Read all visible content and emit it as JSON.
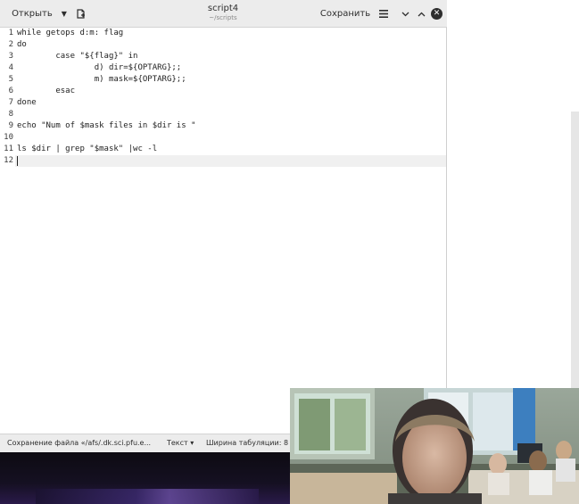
{
  "window": {
    "title": "script4",
    "path": "~/scripts"
  },
  "header": {
    "open_label": "Открыть",
    "save_label": "Сохранить"
  },
  "editor": {
    "line_numbers": [
      "1",
      "2",
      "3",
      "4",
      "5",
      "6",
      "7",
      "8",
      "9",
      "10",
      "11",
      "12"
    ],
    "lines": [
      "while getops d:m: flag",
      "do",
      "        case \"${flag}\" in",
      "                d) dir=${OPTARG};;",
      "                m) mask=${OPTARG};;",
      "        esac",
      "done",
      "",
      "echo \"Num of $mask files in $dir is \"",
      "",
      "ls $dir | grep \"$mask\" |wc -l",
      ""
    ],
    "current_line": "12"
  },
  "status_bar": {
    "message": "Сохранение файла «/afs/.dk.sci.pfu.e...",
    "language": "Текст",
    "tab_width": "Ширина табуляции: 8"
  },
  "icons": [
    "caret-down-icon",
    "new-document-icon",
    "hamburger-menu-icon",
    "minimize-icon",
    "maximize-icon",
    "close-icon"
  ],
  "colors": {
    "header_bg": "#ececec",
    "editor_bg": "#ffffff",
    "current_line_bg": "#f0f0f0",
    "close_button_bg": "#2e2e2e"
  }
}
